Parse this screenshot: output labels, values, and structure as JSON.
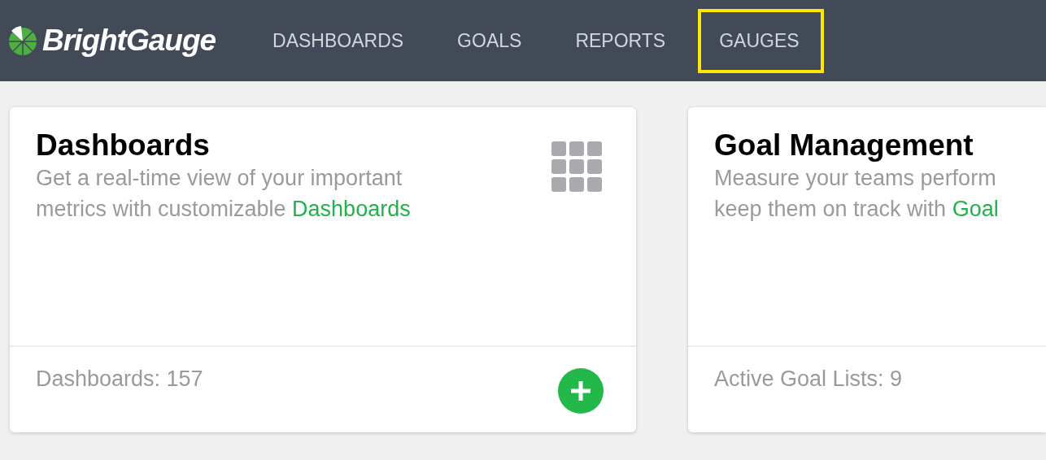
{
  "header": {
    "logo_text": "BrightGauge",
    "nav": [
      {
        "label": "DASHBOARDS",
        "highlighted": false
      },
      {
        "label": "GOALS",
        "highlighted": false
      },
      {
        "label": "REPORTS",
        "highlighted": false
      },
      {
        "label": "GAUGES",
        "highlighted": true
      }
    ]
  },
  "cards": [
    {
      "kind": "grid",
      "title": "Dashboards",
      "description_lines": [
        "Get a real-time view of your important",
        "metrics with customizable "
      ],
      "link": "Dashboards",
      "footer": "Dashboards: 157",
      "add_button": true
    },
    {
      "kind": "none",
      "title": "Goal Management",
      "description_lines": [
        "Measure your teams perform",
        "keep them on track with "
      ],
      "link": "Goal",
      "footer": "Active Goal Lists: 9",
      "add_button": false
    }
  ]
}
